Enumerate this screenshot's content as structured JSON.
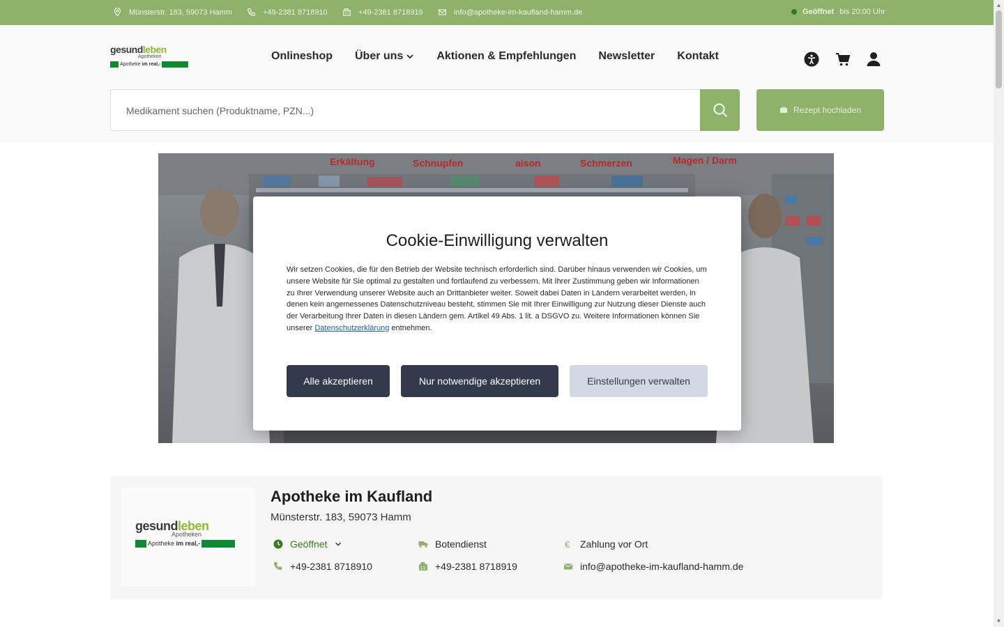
{
  "topbar": {
    "address": "Münsterstr. 183, 59073 Hamm",
    "phone": "+49-2381 8718910",
    "fax": "+49-2381 8718919",
    "email": "info@apotheke-im-kaufland-hamm.de",
    "status": "Geöffnet",
    "hours": "bis 20:00 Uhr"
  },
  "logo": {
    "word_a": "gesund",
    "word_b": "leben",
    "sub": "Apotheken",
    "bar_a": "Apotheke",
    "bar_b": "im real,-"
  },
  "nav": {
    "items": [
      "Onlineshop",
      "Über uns",
      "Aktionen & Empfehlungen",
      "Newsletter",
      "Kontakt"
    ]
  },
  "header_icons": [
    "accessibility-icon",
    "cart-icon",
    "user-icon"
  ],
  "search": {
    "placeholder": "Medikament suchen (Produktname, PZN...)",
    "upload_label": "Rezept hochladen"
  },
  "hero": {
    "shelf_labels": [
      "Erkältung",
      "Schnupfen",
      "aison",
      "Schmerzen",
      "Magen / Darm"
    ]
  },
  "cookie": {
    "title": "Cookie-Einwilligung verwalten",
    "text_before": "Wir setzen Cookies, die für den Betrieb der Website technisch erforderlich sind. Darüber hinaus verwenden wir Cookies, um unsere Website für Sie optimal zu gestalten und fortlaufend zu verbessern. Mit Ihrer Zustimmung geben wir Informationen zu Ihrer Verwendung unserer Website auch an Drittanbieter weiter. Soweit dabei Daten in Ländern verarbeitet werden, in denen kein angemessenes Datenschutzniveau besteht, stimmen Sie mit Ihrer Einwilligung zur Nutzung dieser Dienste auch der Verarbeitung Ihrer Daten in diesen Ländern gem. Artikel 49 Abs. 1 lit. a DSGVO zu. Weitere Informationen können Sie unserer ",
    "link_text": "Datenschutzerklärung",
    "text_after": " entnehmen.",
    "accept_all": "Alle akzeptieren",
    "accept_necessary": "Nur notwendige akzeptieren",
    "settings": "Einstellungen verwalten"
  },
  "pharmacy": {
    "name": "Apotheke im Kaufland",
    "address": "Münsterstr. 183, 59073 Hamm",
    "status": "Geöffnet",
    "delivery": "Botendienst",
    "payment": "Zahlung vor Ort",
    "phone": "+49-2381 8718910",
    "fax": "+49-2381 8718919",
    "email": "info@apotheke-im-kaufland-hamm.de"
  },
  "colors": {
    "brand_green": "#8fb26a",
    "button_dark": "#323a4c",
    "button_light": "#d3d8e4",
    "open_green": "#3b7c22"
  }
}
